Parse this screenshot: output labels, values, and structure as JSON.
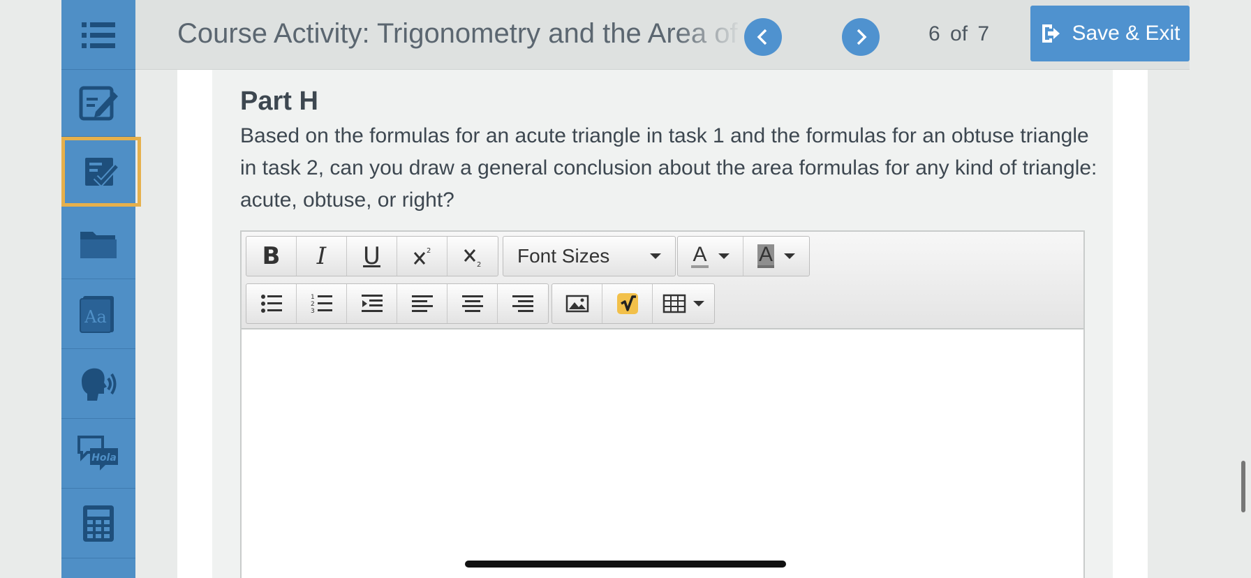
{
  "header": {
    "course_title": "Course Activity: Trigonometry and the Area of Triangles",
    "page_current": "6",
    "page_of": "of",
    "page_total": "7",
    "save_exit_label": "Save & Exit",
    "prev_icon": "chevron-left-icon",
    "next_icon": "chevron-right-icon"
  },
  "sidebar": {
    "items": [
      {
        "icon": "list-icon"
      },
      {
        "icon": "edit-notes-icon"
      },
      {
        "icon": "checked-notes-icon",
        "active": true
      },
      {
        "icon": "folder-icon"
      },
      {
        "icon": "dictionary-icon",
        "label": "Aa"
      },
      {
        "icon": "speaker-head-icon"
      },
      {
        "icon": "translate-icon",
        "label": "Hola"
      },
      {
        "icon": "calculator-icon"
      }
    ]
  },
  "content": {
    "part_title": "Part H",
    "question": "Based on the formulas for an acute triangle in task 1 and the formulas for an obtuse triangle in task 2, can you draw a general conclusion about the area formulas for any kind of triangle: acute, obtuse, or right?"
  },
  "editor": {
    "bold": "B",
    "italic": "I",
    "underline": "U",
    "font_sizes_label": "Font Sizes",
    "font_color_letter": "A",
    "highlight_letter": "A",
    "body_text": ""
  },
  "colors": {
    "sidebar": "#4f8fc6",
    "accent": "#4f92cf",
    "active_outline": "#e6b04c"
  }
}
